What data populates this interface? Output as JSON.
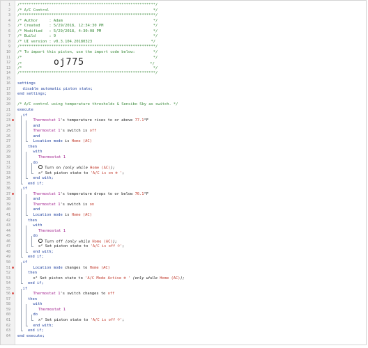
{
  "code_view": {
    "lines": [
      {
        "n": "1",
        "indent": 0,
        "tokens": [
          {
            "t": "/************************************************************/",
            "k": "cm"
          }
        ]
      },
      {
        "n": "2",
        "indent": 0,
        "tokens": [
          {
            "t": "/* A/C Control                                              */",
            "k": "cm"
          }
        ]
      },
      {
        "n": "3",
        "indent": 0,
        "tokens": [
          {
            "t": "/************************************************************/",
            "k": "cm"
          }
        ]
      },
      {
        "n": "4",
        "indent": 0,
        "tokens": [
          {
            "t": "/* Author     : Adam                                        */",
            "k": "cm"
          }
        ]
      },
      {
        "n": "5",
        "indent": 0,
        "tokens": [
          {
            "t": "/* Created    : 5/29/2018, 12:34:30 PM                      */",
            "k": "cm"
          }
        ]
      },
      {
        "n": "6",
        "indent": 0,
        "tokens": [
          {
            "t": "/* Modified   : 5/29/2018, 4:30:08 PM                       */",
            "k": "cm"
          }
        ]
      },
      {
        "n": "7",
        "indent": 0,
        "tokens": [
          {
            "t": "/* Build      : 9                                           */",
            "k": "cm"
          }
        ]
      },
      {
        "n": "8",
        "indent": 0,
        "tokens": [
          {
            "t": "/* UI version : v0.3.104.20180323                          */",
            "k": "cm"
          }
        ]
      },
      {
        "n": "9",
        "indent": 0,
        "tokens": [
          {
            "t": "/************************************************************/",
            "k": "cm"
          }
        ]
      },
      {
        "n": "10",
        "indent": 0,
        "tokens": [
          {
            "t": "/* To import this piston, use the import code below:        */",
            "k": "cm"
          }
        ]
      },
      {
        "n": "11",
        "indent": 0,
        "tokens": [
          {
            "t": "/*                                                          */",
            "k": "cm"
          }
        ]
      },
      {
        "n": "12",
        "indent": 0,
        "big": true,
        "tokens": [
          {
            "t": "/*",
            "k": "cm"
          },
          {
            "t": "              ",
            "k": "txt"
          },
          {
            "t": "oj775",
            "k": "big"
          },
          {
            "t": "                             */",
            "k": "cm"
          }
        ]
      },
      {
        "n": "13",
        "indent": 0,
        "tokens": [
          {
            "t": "/*                                                          */",
            "k": "cm"
          }
        ]
      },
      {
        "n": "14",
        "indent": 0,
        "tokens": [
          {
            "t": "/************************************************************/",
            "k": "cm"
          }
        ]
      },
      {
        "n": "15",
        "indent": 0,
        "tokens": []
      },
      {
        "n": "16",
        "indent": 0,
        "tokens": [
          {
            "t": "settings",
            "k": "kw"
          }
        ]
      },
      {
        "n": "17",
        "indent": 1,
        "tokens": [
          {
            "t": "disable automatic piston state;",
            "k": "kw"
          }
        ]
      },
      {
        "n": "18",
        "indent": 0,
        "tokens": [
          {
            "t": "end settings;",
            "k": "kw"
          }
        ]
      },
      {
        "n": "19",
        "indent": 0,
        "tokens": []
      },
      {
        "n": "20",
        "indent": 0,
        "tokens": [
          {
            "t": "/* A/C control using temperature thresholds & Sensibo Sky as switch. */",
            "k": "cm"
          }
        ]
      },
      {
        "n": "21",
        "indent": 0,
        "tokens": [
          {
            "t": "execute",
            "k": "kw"
          }
        ]
      },
      {
        "n": "22",
        "indent": 1,
        "tokens": [
          {
            "t": "if",
            "k": "kw"
          }
        ]
      },
      {
        "n": "23",
        "indent": 3,
        "warn": true,
        "tokens": [
          {
            "t": "Thermostat 1",
            "k": "dev"
          },
          {
            "t": "'s temperature rises to or above ",
            "k": "txt"
          },
          {
            "t": "77.1",
            "k": "val"
          },
          {
            "t": "°F",
            "k": "txt"
          }
        ]
      },
      {
        "n": "24",
        "indent": 3,
        "tokens": [
          {
            "t": "and",
            "k": "kw"
          }
        ]
      },
      {
        "n": "25",
        "indent": 3,
        "tokens": [
          {
            "t": "Thermostat 1",
            "k": "dev"
          },
          {
            "t": "'s switch is ",
            "k": "txt"
          },
          {
            "t": "off",
            "k": "val"
          }
        ]
      },
      {
        "n": "26",
        "indent": 3,
        "tokens": [
          {
            "t": "and",
            "k": "kw"
          }
        ]
      },
      {
        "n": "27",
        "indent": 3,
        "tokens": [
          {
            "t": "Location mode",
            "k": "attr"
          },
          {
            "t": " is ",
            "k": "txt"
          },
          {
            "t": "Home (AC)",
            "k": "val"
          }
        ]
      },
      {
        "n": "28",
        "indent": 2,
        "tokens": [
          {
            "t": "then",
            "k": "kw"
          }
        ]
      },
      {
        "n": "29",
        "indent": 3,
        "tokens": [
          {
            "t": "with",
            "k": "kw"
          }
        ]
      },
      {
        "n": "30",
        "indent": 4,
        "tokens": [
          {
            "t": "Thermostat 1",
            "k": "dev"
          }
        ]
      },
      {
        "n": "31",
        "indent": 3,
        "tokens": [
          {
            "t": "do",
            "k": "kw"
          }
        ]
      },
      {
        "n": "32",
        "indent": 4,
        "circle": true,
        "tokens": [
          {
            "t": " Turn on ",
            "k": "txt"
          },
          {
            "t": "(only while ",
            "k": "em"
          },
          {
            "t": "Home (AC)",
            "k": "val"
          },
          {
            "t": ");",
            "k": "em"
          }
        ]
      },
      {
        "n": "33",
        "indent": 4,
        "tokens": [
          {
            "t": "x²",
            "k": "txt"
          },
          {
            "t": " Set piston state to ",
            "k": "txt"
          },
          {
            "t": "'A/C is on ❄ '",
            "k": "str"
          },
          {
            "t": ";",
            "k": "txt"
          }
        ]
      },
      {
        "n": "34",
        "indent": 3,
        "tokens": [
          {
            "t": "end with;",
            "k": "kw"
          }
        ]
      },
      {
        "n": "35",
        "indent": 2,
        "tokens": [
          {
            "t": "end if;",
            "k": "kw"
          }
        ]
      },
      {
        "n": "36",
        "indent": 1,
        "tokens": [
          {
            "t": "if",
            "k": "kw"
          }
        ]
      },
      {
        "n": "37",
        "indent": 3,
        "warn": true,
        "tokens": [
          {
            "t": "Thermostat 1",
            "k": "dev"
          },
          {
            "t": "'s temperature drops to or below ",
            "k": "txt"
          },
          {
            "t": "76.1",
            "k": "val"
          },
          {
            "t": "°F",
            "k": "txt"
          }
        ]
      },
      {
        "n": "38",
        "indent": 3,
        "tokens": [
          {
            "t": "and",
            "k": "kw"
          }
        ]
      },
      {
        "n": "39",
        "indent": 3,
        "tokens": [
          {
            "t": "Thermostat 1",
            "k": "dev"
          },
          {
            "t": "'s switch is ",
            "k": "txt"
          },
          {
            "t": "on",
            "k": "val"
          }
        ]
      },
      {
        "n": "40",
        "indent": 3,
        "tokens": [
          {
            "t": "and",
            "k": "kw"
          }
        ]
      },
      {
        "n": "41",
        "indent": 3,
        "tokens": [
          {
            "t": "Location mode",
            "k": "attr"
          },
          {
            "t": " is ",
            "k": "txt"
          },
          {
            "t": "Home (AC)",
            "k": "val"
          }
        ]
      },
      {
        "n": "42",
        "indent": 2,
        "tokens": [
          {
            "t": "then",
            "k": "kw"
          }
        ]
      },
      {
        "n": "43",
        "indent": 3,
        "tokens": [
          {
            "t": "with",
            "k": "kw"
          }
        ]
      },
      {
        "n": "44",
        "indent": 4,
        "tokens": [
          {
            "t": "Thermostat 1",
            "k": "dev"
          }
        ]
      },
      {
        "n": "45",
        "indent": 3,
        "tokens": [
          {
            "t": "do",
            "k": "kw"
          }
        ]
      },
      {
        "n": "46",
        "indent": 4,
        "circle": true,
        "tokens": [
          {
            "t": " Turn off ",
            "k": "txt"
          },
          {
            "t": "(only while ",
            "k": "em"
          },
          {
            "t": "Home (AC)",
            "k": "val"
          },
          {
            "t": ");",
            "k": "em"
          }
        ]
      },
      {
        "n": "47",
        "indent": 4,
        "tokens": [
          {
            "t": "x²",
            "k": "txt"
          },
          {
            "t": " Set piston state to ",
            "k": "txt"
          },
          {
            "t": "'A/C is off ☹'",
            "k": "str"
          },
          {
            "t": ";",
            "k": "txt"
          }
        ]
      },
      {
        "n": "48",
        "indent": 3,
        "tokens": [
          {
            "t": "end with;",
            "k": "kw"
          }
        ]
      },
      {
        "n": "49",
        "indent": 2,
        "tokens": [
          {
            "t": "end if;",
            "k": "kw"
          }
        ]
      },
      {
        "n": "50",
        "indent": 1,
        "tokens": [
          {
            "t": "if",
            "k": "kw"
          }
        ]
      },
      {
        "n": "51",
        "indent": 3,
        "warn": true,
        "tokens": [
          {
            "t": "Location mode",
            "k": "attr"
          },
          {
            "t": " changes to ",
            "k": "txt"
          },
          {
            "t": "Home (AC)",
            "k": "val"
          }
        ]
      },
      {
        "n": "52",
        "indent": 2,
        "tokens": [
          {
            "t": "then",
            "k": "kw"
          }
        ]
      },
      {
        "n": "53",
        "indent": 3,
        "tokens": [
          {
            "t": "x²",
            "k": "txt"
          },
          {
            "t": " Set piston state to ",
            "k": "txt"
          },
          {
            "t": "'A/C Mode Active ❄ '",
            "k": "str"
          },
          {
            "t": " (only while ",
            "k": "em"
          },
          {
            "t": "Home (AC)",
            "k": "val"
          },
          {
            "t": ");",
            "k": "em"
          }
        ]
      },
      {
        "n": "54",
        "indent": 2,
        "tokens": [
          {
            "t": "end if;",
            "k": "kw"
          }
        ]
      },
      {
        "n": "55",
        "indent": 1,
        "tokens": [
          {
            "t": "if",
            "k": "kw"
          }
        ]
      },
      {
        "n": "56",
        "indent": 3,
        "warn": true,
        "tokens": [
          {
            "t": "Thermostat 1",
            "k": "dev"
          },
          {
            "t": "'s switch changes to ",
            "k": "txt"
          },
          {
            "t": "off",
            "k": "val"
          }
        ]
      },
      {
        "n": "57",
        "indent": 2,
        "tokens": [
          {
            "t": "then",
            "k": "kw"
          }
        ]
      },
      {
        "n": "58",
        "indent": 3,
        "tokens": [
          {
            "t": "with",
            "k": "kw"
          }
        ]
      },
      {
        "n": "59",
        "indent": 4,
        "tokens": [
          {
            "t": "Thermostat 1",
            "k": "dev"
          }
        ]
      },
      {
        "n": "60",
        "indent": 3,
        "tokens": [
          {
            "t": "do",
            "k": "kw"
          }
        ]
      },
      {
        "n": "61",
        "indent": 4,
        "tokens": [
          {
            "t": "x²",
            "k": "txt"
          },
          {
            "t": " Set piston state to ",
            "k": "txt"
          },
          {
            "t": "'A/C is off ☹'",
            "k": "str"
          },
          {
            "t": ";",
            "k": "txt"
          }
        ]
      },
      {
        "n": "62",
        "indent": 3,
        "tokens": [
          {
            "t": "end with;",
            "k": "kw"
          }
        ]
      },
      {
        "n": "63",
        "indent": 2,
        "tokens": [
          {
            "t": "end if;",
            "k": "kw"
          }
        ]
      },
      {
        "n": "64",
        "indent": 0,
        "tokens": [
          {
            "t": "end execute;",
            "k": "kw"
          }
        ]
      }
    ]
  },
  "colors": {
    "comment": "#3a8a3a",
    "keyword": "#1e3f9e",
    "device": "#a01e8c",
    "value": "#c0392b",
    "warning": "#d9534f"
  }
}
